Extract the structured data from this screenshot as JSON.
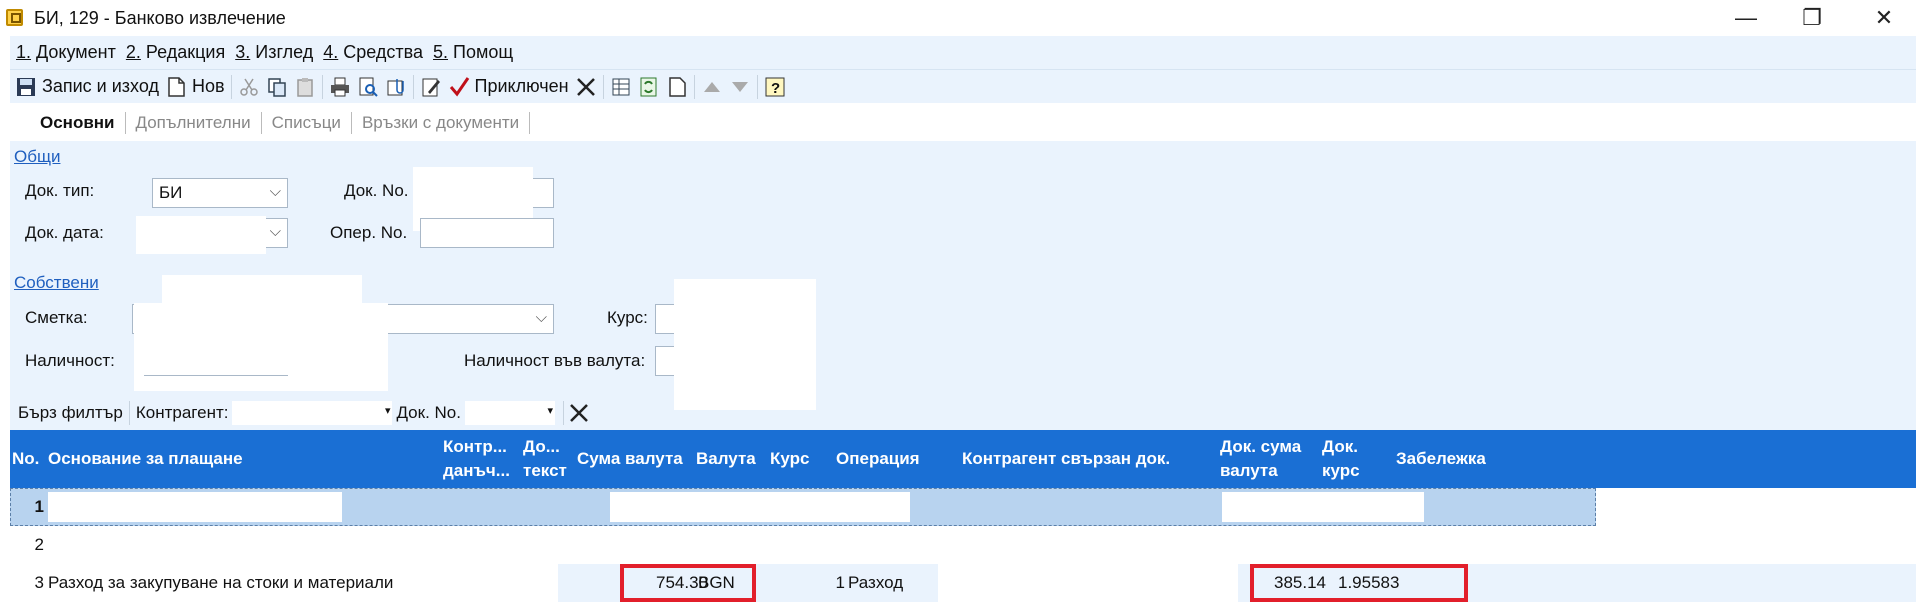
{
  "window": {
    "title": "БИ, 129 - Банково извлечение",
    "controls": [
      "—",
      "❐",
      "✕"
    ]
  },
  "menu": [
    {
      "key": "1.",
      "label": " Документ"
    },
    {
      "key": "2.",
      "label": " Редакция"
    },
    {
      "key": "3.",
      "label": " Изглед"
    },
    {
      "key": "4.",
      "label": " Средства"
    },
    {
      "key": "5.",
      "label": " Помощ"
    }
  ],
  "toolbar": {
    "save_exit_label": "Запис и изход",
    "new_label": "Нов",
    "closed_label": "Приключен"
  },
  "tabs": [
    "Основни",
    "Допълнителни",
    "Списъци",
    "Връзки с документи"
  ],
  "form": {
    "general_title": "Общи",
    "doc_type_label": "Док. тип:",
    "doc_type_value": "БИ",
    "doc_no_label": "Док. No.",
    "doc_date_label": "Док. дата:",
    "oper_no_label": "Опер. No.",
    "own_title": "Собствени",
    "account_label": "Сметка:",
    "rate_label": "Курс:",
    "balance_label": "Наличност:",
    "balance_currency_label": "Наличност във валута:"
  },
  "filter": {
    "quick_filter_label": "Бърз филтър",
    "counterparty_label": "Контрагент:",
    "doc_no_label": "Док. No."
  },
  "grid": {
    "headers": {
      "no": "No.",
      "basis": "Основание за плащане",
      "counterparty_tax_1": "Контр...",
      "counterparty_tax_2": "данъч...",
      "doc_text_1": "До...",
      "doc_text_2": "текст",
      "amount_currency": "Сума валута",
      "currency": "Валута",
      "rate": "Курс",
      "operation": "Операция",
      "linked_doc": "Контрагент свързан док.",
      "doc_amount_1": "Док. сума",
      "doc_amount_2": "валута",
      "doc_rate_1": "Док.",
      "doc_rate_2": "курс",
      "note": "Забележка"
    },
    "rows": [
      {
        "no": "1",
        "basis": "",
        "amount": "",
        "currency": "",
        "operation_no": "",
        "operation": "",
        "doc_amount": "",
        "doc_rate": ""
      },
      {
        "no": "2",
        "basis": "",
        "amount": "",
        "currency": "",
        "operation_no": "",
        "operation": "",
        "doc_amount": "",
        "doc_rate": ""
      },
      {
        "no": "3",
        "basis": "Разход за закупуване на стоки и материали",
        "amount": "754.30",
        "currency": "BGN",
        "operation_no": "1",
        "operation": "Разход",
        "doc_amount": "385.14",
        "doc_rate": "1.95583"
      }
    ]
  },
  "colors": {
    "accent": "#1a6fd4",
    "panel_bg": "#eaf3fd",
    "highlight_box": "#e21f2b",
    "link": "#1f5fbf"
  }
}
